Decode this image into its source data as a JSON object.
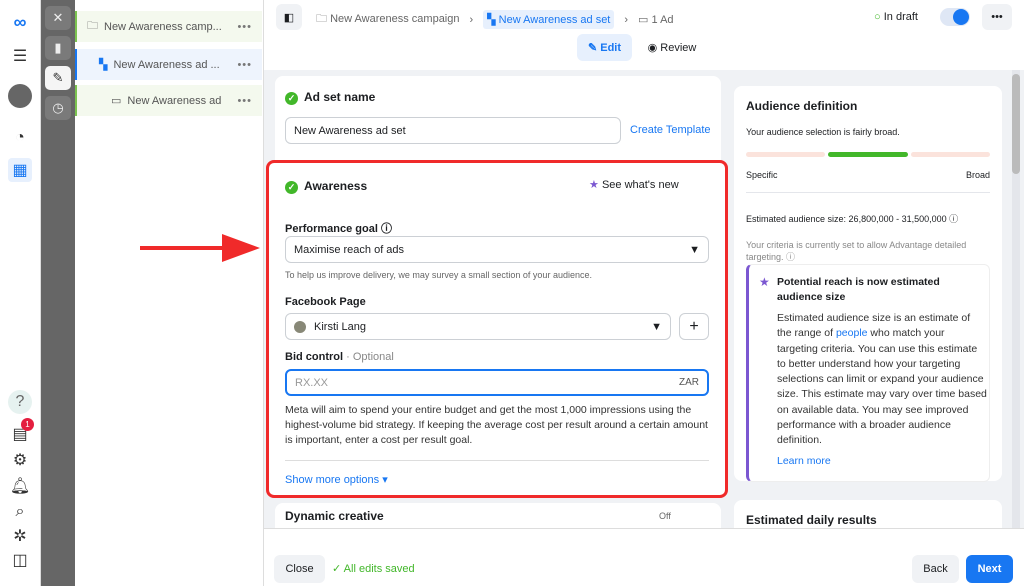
{
  "nav": {
    "icons": [
      "meta-logo",
      "menu",
      "avatar",
      "dashboard",
      "campaigns-table",
      "help",
      "news",
      "settings",
      "notifications",
      "search",
      "bug",
      "panel-toggle"
    ],
    "news_badge": "1"
  },
  "sidebar_tools": [
    "close",
    "chart",
    "edit",
    "history"
  ],
  "tree": [
    {
      "label": "New Awareness camp...",
      "icon": "folder"
    },
    {
      "label": "New Awareness ad ...",
      "icon": "adset-grid"
    },
    {
      "label": "New Awareness ad",
      "icon": "ad"
    }
  ],
  "breadcrumb": [
    "New Awareness campaign",
    "New Awareness ad set",
    "1 Ad"
  ],
  "status": "In draft",
  "toggle_on": true,
  "modes": {
    "edit": "Edit",
    "review": "Review"
  },
  "adset": {
    "title": "Ad set name",
    "name_value": "New Awareness ad set",
    "create_template": "Create Template"
  },
  "awareness": {
    "title": "Awareness",
    "whats_new": "See what's new",
    "perf_goal_label": "Performance goal",
    "perf_goal_value": "Maximise reach of ads",
    "perf_note": "To help us improve delivery, we may survey a small section of your audience.",
    "page_label": "Facebook Page",
    "page_value": "Kirsti Lang",
    "bid_label": "Bid control",
    "bid_optional": "· Optional",
    "bid_placeholder": "RX.XX",
    "currency": "ZAR",
    "bid_note": "Meta will aim to spend your entire budget and get the most 1,000 impressions using the highest-volume bid strategy. If keeping the average cost per result around a certain amount is important, enter a cost per result goal.",
    "show_more": "Show more options"
  },
  "dynamic": {
    "title": "Dynamic creative",
    "state": "Off"
  },
  "audience": {
    "title": "Audience definition",
    "summary": "Your audience selection is fairly broad.",
    "specific": "Specific",
    "broad": "Broad",
    "level": "middle",
    "size": "Estimated audience size: 26,800,000 - 31,500,000",
    "criteria": "Your criteria is currently set to allow Advantage detailed targeting.",
    "callout_title": "Potential reach is now estimated audience size",
    "callout_a": "Estimated audience size is an estimate of the range of ",
    "callout_link": "people",
    "callout_b": " who match your targeting criteria. You can use this estimate to better understand how your targeting selections can limit or expand your audience size. This estimate may vary over time based on available data. You may see improved performance with a broader audience definition.",
    "learn_more": "Learn more"
  },
  "daily": {
    "title": "Estimated daily results"
  },
  "footer": {
    "close": "Close",
    "saved": "All edits saved",
    "back": "Back",
    "next": "Next"
  },
  "colors": {
    "accent": "#1877f2",
    "success": "#42b72a",
    "highlight": "#f02a2a"
  }
}
